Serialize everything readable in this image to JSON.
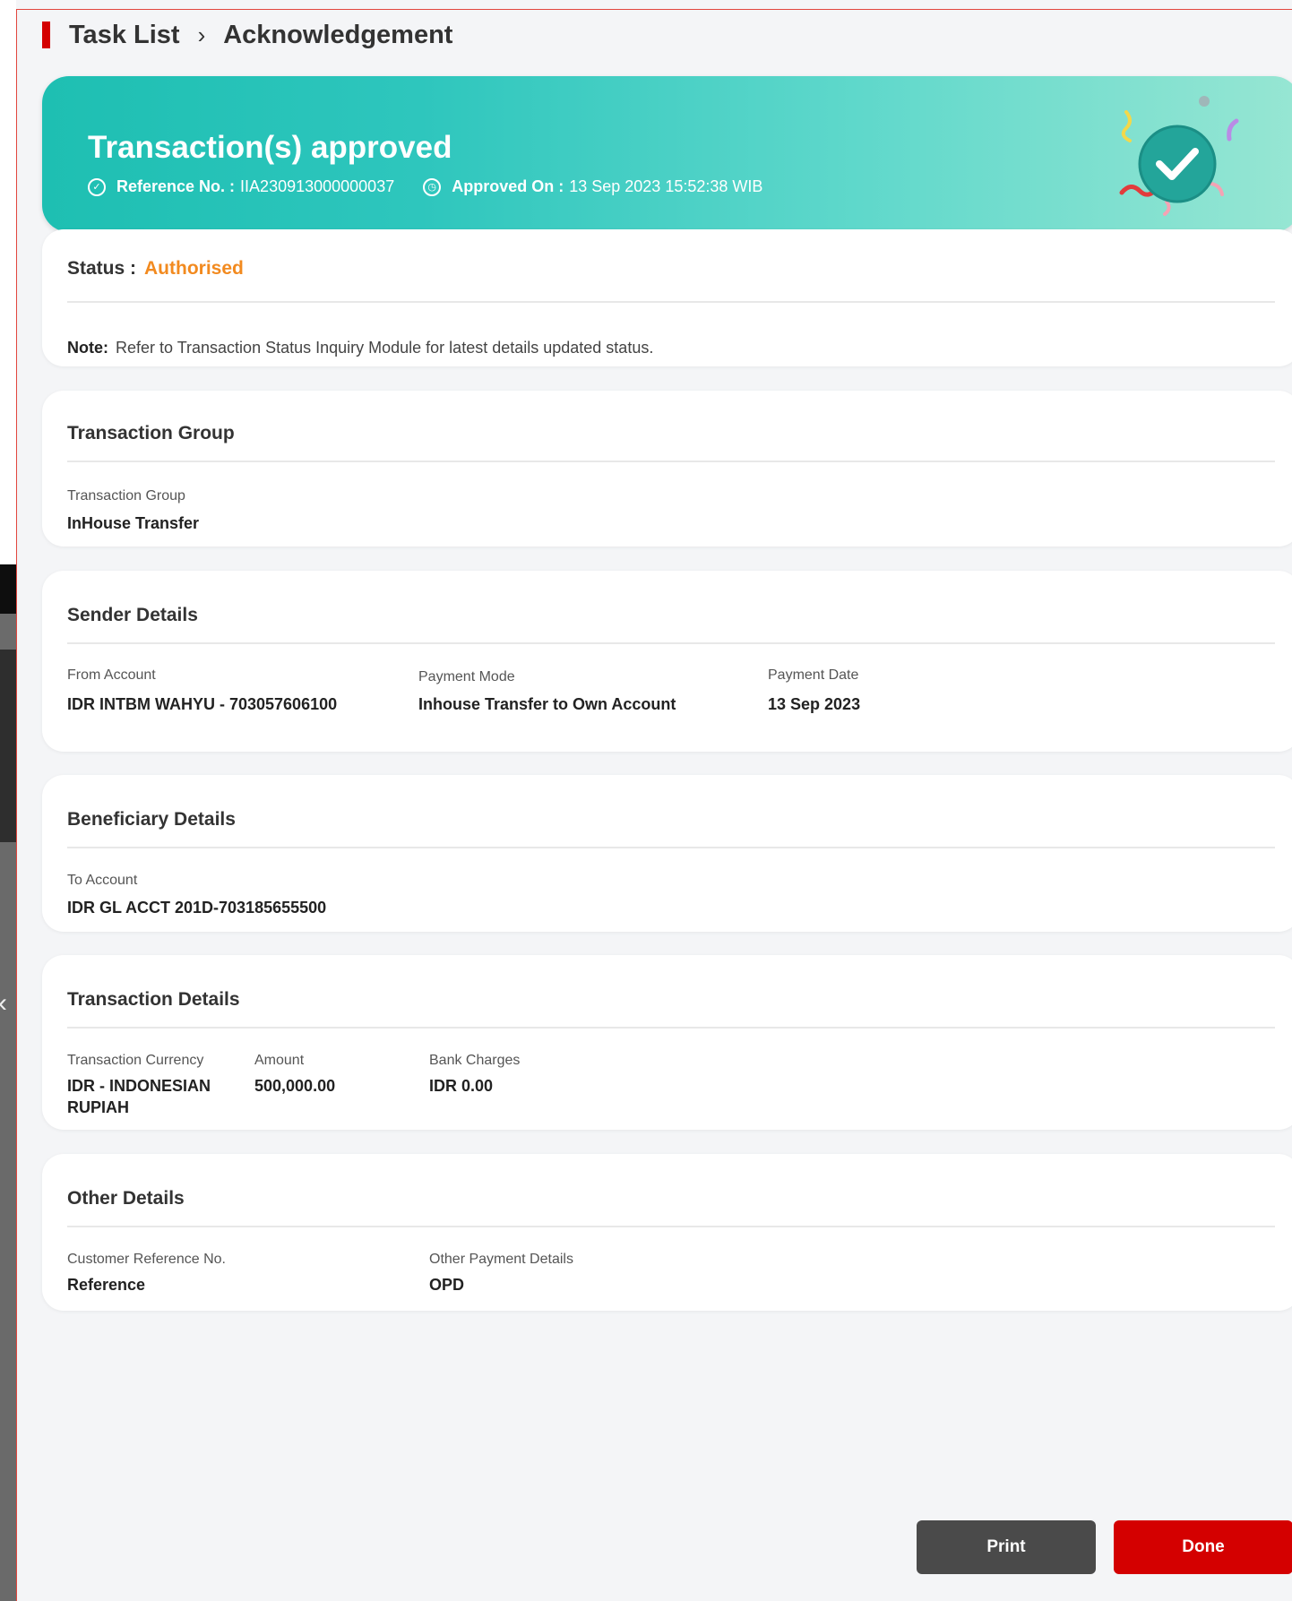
{
  "breadcrumb": {
    "parent": "Task List",
    "separator": "›",
    "current": "Acknowledgement"
  },
  "banner": {
    "title": "Transaction(s) approved",
    "reference_label": "Reference No. :",
    "reference_value": "IIA230913000000037",
    "approved_label": "Approved On :",
    "approved_value": "13 Sep 2023 15:52:38 WIB"
  },
  "status": {
    "label": "Status :",
    "value": "Authorised",
    "note_label": "Note:",
    "note_text": "Refer to Transaction Status Inquiry Module for latest details updated status."
  },
  "transaction_group": {
    "title": "Transaction Group",
    "field_label": "Transaction Group",
    "field_value": "InHouse Transfer"
  },
  "sender": {
    "title": "Sender Details",
    "from_account_label": "From Account",
    "from_account_value": "IDR INTBM WAHYU - 703057606100",
    "payment_mode_label": "Payment Mode",
    "payment_mode_value": "Inhouse Transfer to Own Account",
    "payment_date_label": "Payment Date",
    "payment_date_value": "13 Sep 2023"
  },
  "beneficiary": {
    "title": "Beneficiary Details",
    "to_account_label": "To Account",
    "to_account_value": "IDR GL ACCT 201D-703185655500"
  },
  "transaction_details": {
    "title": "Transaction Details",
    "currency_label": "Transaction Currency",
    "currency_value_line1": "IDR - INDONESIAN",
    "currency_value_line2": "RUPIAH",
    "amount_label": "Amount",
    "amount_value": "500,000.00",
    "charges_label": "Bank Charges",
    "charges_value": "IDR 0.00"
  },
  "other_details": {
    "title": "Other Details",
    "customer_ref_label": "Customer Reference No.",
    "customer_ref_value": "Reference",
    "other_payment_label": "Other Payment Details",
    "other_payment_value": "OPD"
  },
  "actions": {
    "print_label": "Print",
    "done_label": "Done"
  },
  "colors": {
    "brand_red": "#d40000",
    "status_orange": "#f28a1f",
    "banner_teal": "#1ebfb2",
    "print_gray": "#4a4a4a"
  }
}
